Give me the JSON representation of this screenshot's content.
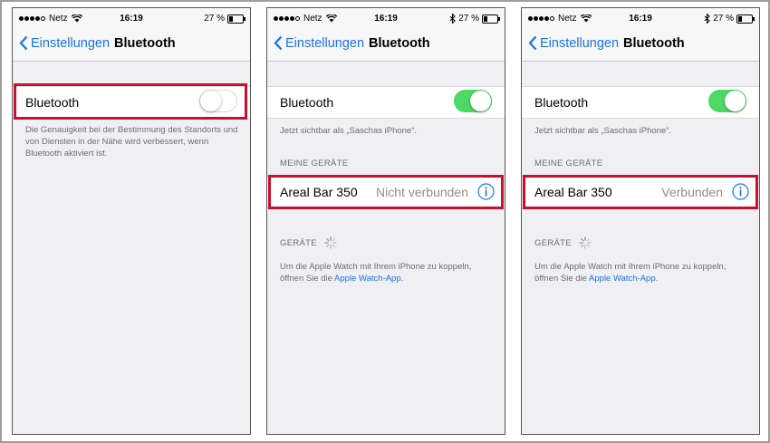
{
  "colors": {
    "accent": "#1a73e8",
    "toggle_on": "#4cd964",
    "highlight": "#c8102e",
    "background": "#efeff4"
  },
  "panels": [
    {
      "status": {
        "carrier": "Netz",
        "time": "16:19",
        "battery": "27 %",
        "battery_level": 0.27,
        "bluetooth_icon": false
      },
      "nav": {
        "back_label": "Einstellungen",
        "title": "Bluetooth"
      },
      "bluetooth_row": {
        "label": "Bluetooth",
        "toggle_on": false
      },
      "footnote": "Die Genauigkeit bei der Bestimmung des Standorts und von Diensten in der Nähe wird verbessert, wenn Bluetooth aktiviert ist."
    },
    {
      "status": {
        "carrier": "Netz",
        "time": "16:19",
        "battery": "27 %",
        "battery_level": 0.27,
        "bluetooth_icon": true
      },
      "nav": {
        "back_label": "Einstellungen",
        "title": "Bluetooth"
      },
      "bluetooth_row": {
        "label": "Bluetooth",
        "toggle_on": true
      },
      "visible_as": "Jetzt sichtbar als „Saschas iPhone“.",
      "my_devices_header": "MEINE GERÄTE",
      "device": {
        "name": "Areal Bar 350",
        "status": "Nicht verbunden",
        "icon": "info-icon"
      },
      "devices_header": "GERÄTE",
      "watch_text": "Um die Apple Watch mit Ihrem iPhone zu koppeln, öffnen Sie die ",
      "watch_link": "Apple Watch-App",
      "watch_end": "."
    },
    {
      "status": {
        "carrier": "Netz",
        "time": "16:19",
        "battery": "27 %",
        "battery_level": 0.27,
        "bluetooth_icon": true
      },
      "nav": {
        "back_label": "Einstellungen",
        "title": "Bluetooth"
      },
      "bluetooth_row": {
        "label": "Bluetooth",
        "toggle_on": true
      },
      "visible_as": "Jetzt sichtbar als „Saschas iPhone“.",
      "my_devices_header": "MEINE GERÄTE",
      "device": {
        "name": "Areal Bar 350",
        "status": "Verbunden",
        "icon": "info-icon"
      },
      "devices_header": "GERÄTE",
      "watch_text": "Um die Apple Watch mit Ihrem iPhone zu koppeln, öffnen Sie die ",
      "watch_link": "Apple Watch-App",
      "watch_end": "."
    }
  ]
}
